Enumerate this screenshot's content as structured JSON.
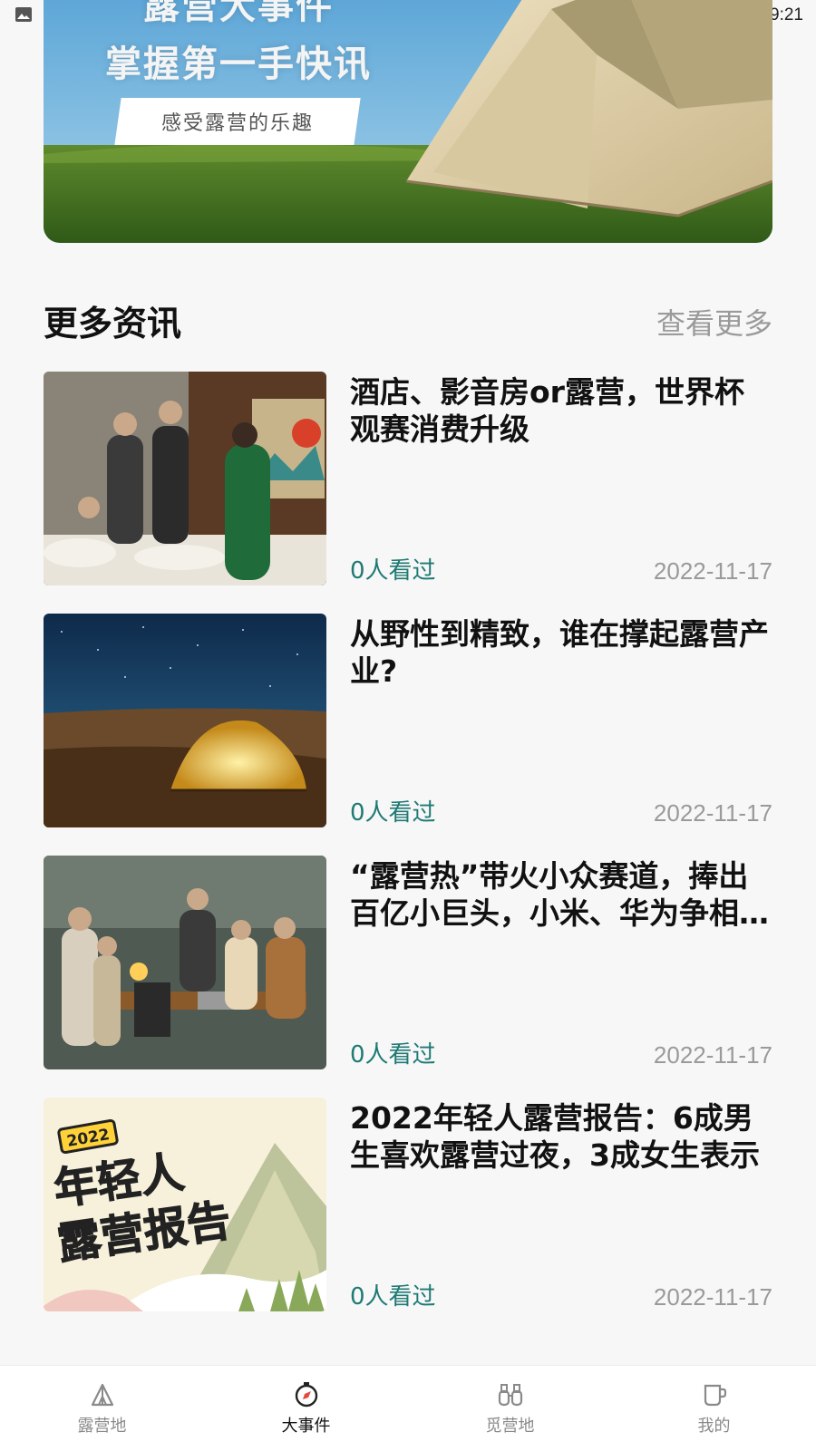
{
  "status_bar": {
    "time": "9:21",
    "icons": [
      "gallery-icon",
      "a-text-icon",
      "wifi-icon",
      "battery-icon"
    ]
  },
  "banner": {
    "title_line1": "露营大事件",
    "title_line2": "掌握第一手快讯",
    "tagline": "感受露营的乐趣"
  },
  "section": {
    "title": "更多资讯",
    "more_label": "查看更多"
  },
  "news": [
    {
      "title": "酒店、影音房or露营，世界杯观赛消费升级",
      "views": "0人看过",
      "date": "2022-11-17",
      "thumb": "world-cup-party-photo"
    },
    {
      "title": "从野性到精致，谁在撑起露营产业?",
      "views": "0人看过",
      "date": "2022-11-17",
      "thumb": "night-tent-photo"
    },
    {
      "title": "“露营热”带火小众赛道，捧出百亿小巨头，小米、华为争相入局",
      "views": "0人看过",
      "date": "2022-11-17",
      "thumb": "family-camping-photo"
    },
    {
      "title": "2022年轻人露营报告：6成男生喜欢露营过夜，3成女生表示",
      "views": "0人看过",
      "date": "2022-11-17",
      "thumb": "youth-camping-report-poster",
      "thumb_text": {
        "badge": "2022",
        "line1": "年轻人",
        "line2": "露营报告"
      }
    }
  ],
  "bottom_nav": [
    {
      "label": "露营地",
      "icon": "tent-icon",
      "active": false
    },
    {
      "label": "大事件",
      "icon": "compass-icon",
      "active": true
    },
    {
      "label": "觅营地",
      "icon": "binoculars-icon",
      "active": false
    },
    {
      "label": "我的",
      "icon": "cup-icon",
      "active": false
    }
  ]
}
